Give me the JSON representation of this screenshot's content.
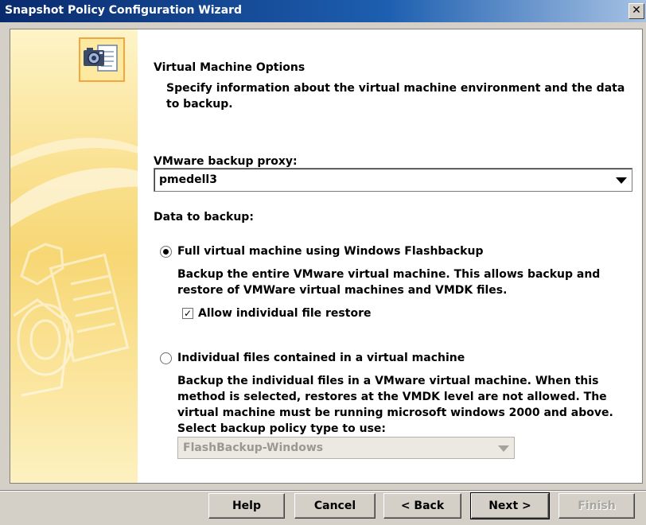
{
  "window": {
    "title": "Snapshot Policy Configuration Wizard",
    "close_label": "✕"
  },
  "page": {
    "heading": "Virtual Machine Options",
    "description": "Specify information about the virtual machine environment and the data to backup."
  },
  "proxy": {
    "label": "VMware backup proxy:",
    "value": "pmedell3"
  },
  "data_to_backup": {
    "label": "Data to backup:",
    "option_full": {
      "label": "Full virtual machine using Windows Flashbackup",
      "selected": true,
      "description": "Backup the entire VMware virtual machine. This allows backup and restore of VMWare virtual machines and VMDK files.",
      "allow_restore_label": "Allow individual file restore",
      "allow_restore_checked": true
    },
    "option_individual": {
      "label": "Individual files contained in a virtual machine",
      "selected": false,
      "description": "Backup the individual files in a VMware virtual machine. When this method is selected, restores at the VMDK level are not allowed. The virtual machine must be running microsoft windows 2000 and above."
    },
    "policy_type": {
      "label": "Select backup policy type to use:",
      "value": "FlashBackup-Windows"
    }
  },
  "buttons": {
    "help": "Help",
    "cancel": "Cancel",
    "back": "< Back",
    "next": "Next >",
    "finish": "Finish"
  },
  "colors": {
    "title_start": "#0a2a6e",
    "title_end": "#a7c2e4",
    "sidebar": "#f7d774",
    "icon_border": "#f3a640"
  },
  "icons": {
    "wizard": "camera-document-icon",
    "watermark": "camera-document-watermark"
  }
}
